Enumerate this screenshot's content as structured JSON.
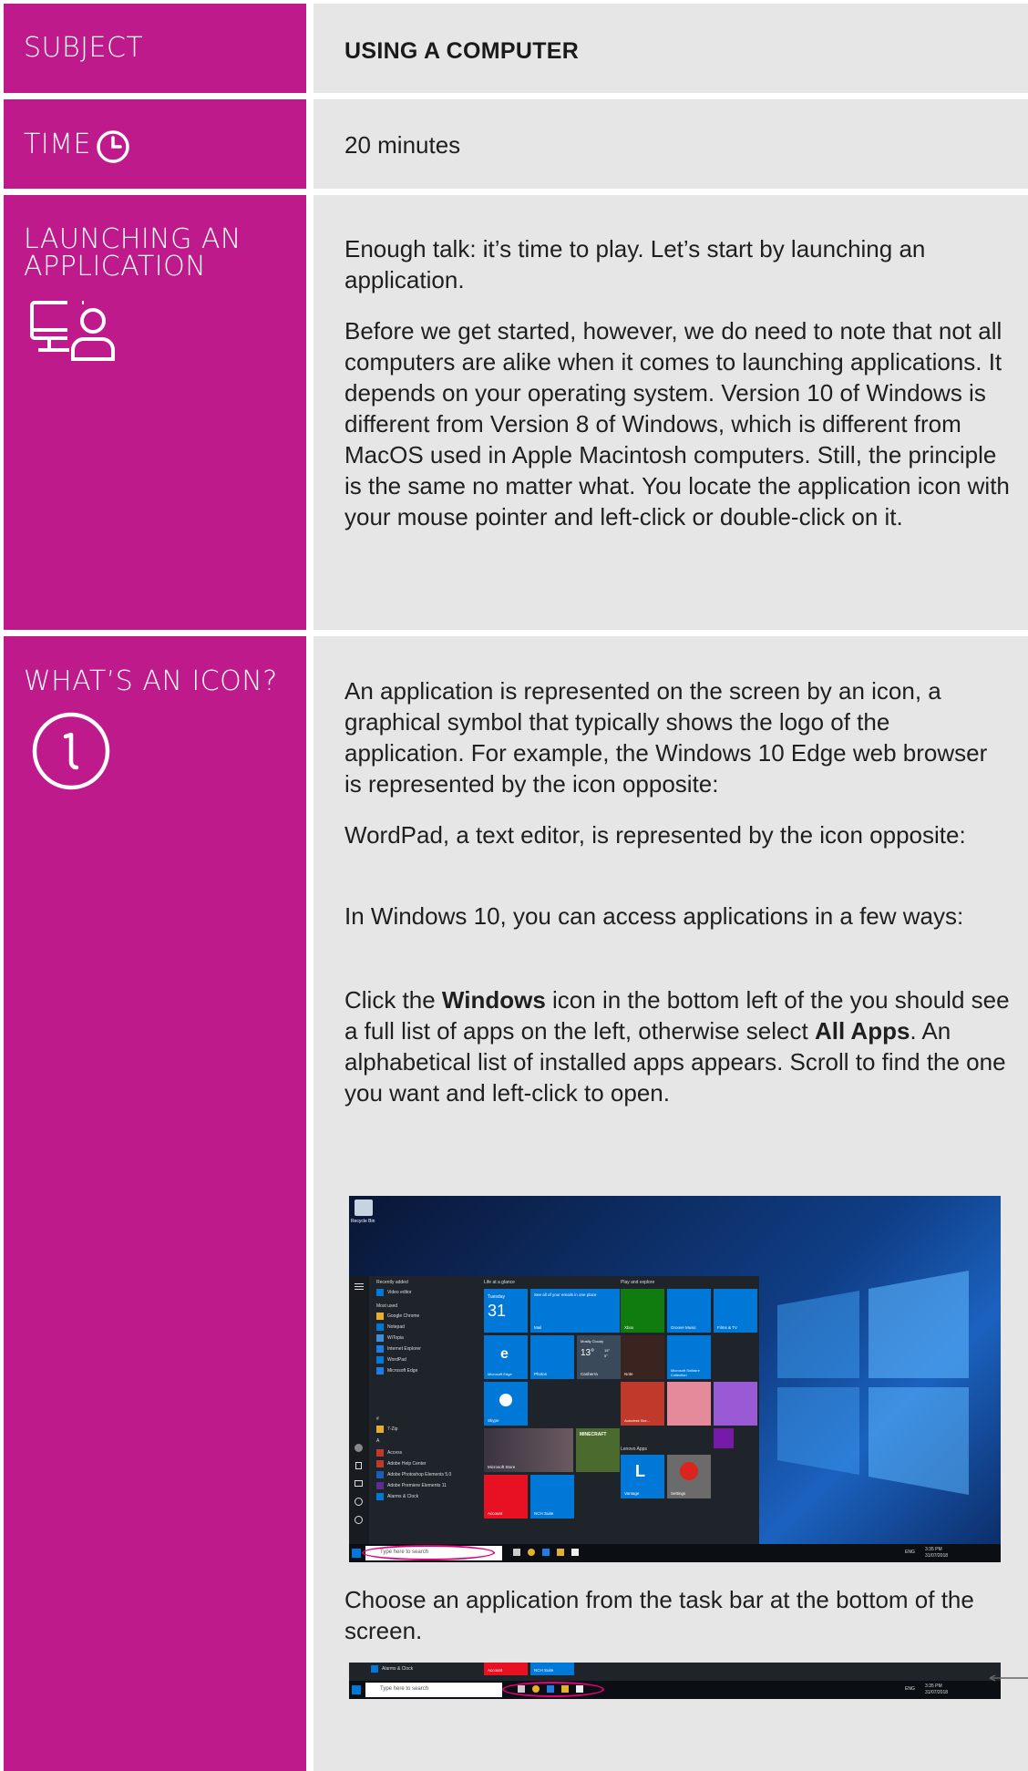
{
  "subject": {
    "label": "SUBJECT",
    "value": "USING A COMPUTER"
  },
  "time": {
    "label": "TIME",
    "value": "20 minutes",
    "icon": "clock-icon"
  },
  "launching": {
    "label_line1": "LAUNCHING AN",
    "label_line2": "APPLICATION",
    "icon": "computer-user-icon",
    "para1": "Enough talk: it’s time to play. Let’s start by launching an application.",
    "para2": "Before we get started, however, we do need to note that not all computers are alike when it comes to launching applications. It depends on your operating system. Version 10 of Windows is different from Version 8 of Windows, which is different from MacOS used in Apple Macintosh computers. Still, the principle is the same no matter what. You locate the application icon with your mouse pointer and left-click or double-click on it."
  },
  "icon_section": {
    "label": "WHAT’S AN ICON?",
    "icon": "info-circle-icon",
    "para1": "An application is represented on the screen by an icon, a graphical symbol that typically shows the logo of the application. For example, the Windows 10 Edge web browser is represented by the icon opposite:",
    "para2": "WordPad, a text editor, is represented by the icon opposite:",
    "para3": "In Windows 10, you can access applications in a few ways:",
    "para4_a": "Click the ",
    "para4_b": "Windows",
    "para4_c": " icon in the bottom left of the you should see a full list of apps on the left, otherwise select ",
    "para4_d": "All Apps",
    "para4_e": ". An alphabetical list of installed apps appears. Scroll to find the one you want and left-click to open.",
    "para5": "Choose an application from the task bar at the bottom of the screen."
  },
  "screenshot": {
    "recycle_bin": "Recycle Bin",
    "recently_added": "Recently added",
    "most_used": "Most used",
    "apps": [
      "Video editor",
      "Google Chrome",
      "Notepad",
      "WiTopia",
      "Internet Explorer",
      "WordPad",
      "Microsoft Edge",
      "7-Zip",
      "Access",
      "Adobe Help Center",
      "Adobe Photoshop Elements 5.0",
      "Adobe Premiere Elements 11",
      "Alarms & Clock"
    ],
    "section_hash": "#",
    "section_a": "A",
    "life_at_glance": "Life at a glance",
    "play_explore": "Play and explore",
    "tiles": {
      "calendar_day": "Tuesday",
      "calendar_num": "31",
      "mail_text": "See all of your emails in one place",
      "mail": "Mail",
      "xbox": "Xbox",
      "groove": "Groove Music",
      "films": "Films & TV",
      "edge": "Microsoft Edge",
      "photos": "Photos",
      "weather_title": "Mostly Cloudy",
      "weather_temp": "13°",
      "weather_hi": "15°",
      "weather_lo": "5°",
      "weather_city": "Canberra",
      "solitaire": "Microsoft Solitaire Collection",
      "skype": "Skype",
      "store": "Microsoft Store",
      "minecraft": "MINECRAFT",
      "lenovo_apps": "Lenovo Apps",
      "vantage": "Vantage",
      "settings": "Settings",
      "account": "Account",
      "nch": "NCH Suite",
      "note": "Note",
      "autodesk": "Autodesk Ske..."
    },
    "search_placeholder": "Type here to search",
    "tray_lang": "ENG",
    "tray_time": "3:35 PM",
    "tray_date": "31/07/2018"
  },
  "taskbar_strip": {
    "alarms": "Alarms & Clock",
    "audio": "Audacity",
    "account": "Account",
    "nch": "NCH Suite",
    "search_placeholder": "Type here to search",
    "tray_lang": "ENG",
    "tray_time": "3:35 PM",
    "tray_date": "31/07/2018"
  },
  "colors": {
    "magenta": "#be1a8c",
    "panel": "#e6e6e6",
    "win_blue": "#0078d7",
    "highlight_ring": "#e3007d"
  }
}
